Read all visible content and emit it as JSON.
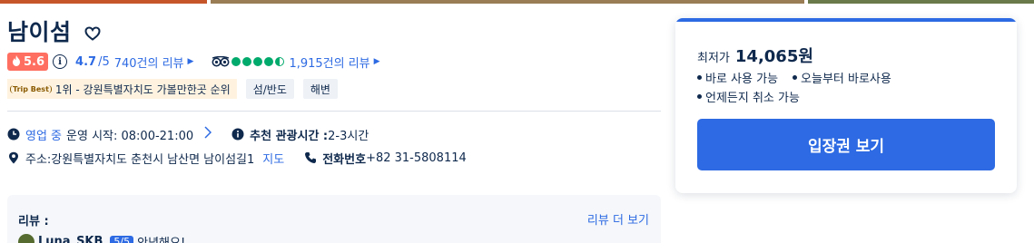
{
  "title": "남이섬",
  "hot_score": "5.6",
  "rating": {
    "score": "4.7",
    "scale": "/5",
    "review_count_text": "740건의 리뷰"
  },
  "tripadvisor": {
    "bubbles_filled": 4.5,
    "review_count_text": "1,915건의 리뷰"
  },
  "tripbest": {
    "label": "Trip Best",
    "text": "1위 - 강원특별자치도 가볼만한곳 순위"
  },
  "tags": [
    "섬/반도",
    "해변"
  ],
  "info": {
    "status": "영업 중",
    "hours": "운영 시작: 08:00-21:00",
    "recommended_label": "추천 관광시간 :",
    "recommended_value": "2-3시간",
    "address": "주소:강원특별자치도 춘천시 남산면 남이섬길1",
    "map_link": "지도",
    "phone_label": "전화번호",
    "phone_value": "+82 31-5808114"
  },
  "review_section": {
    "title": "리뷰 :",
    "more_link": "리뷰 더 보기",
    "first_review": {
      "user": "Luna_SKB",
      "rating": "5/5",
      "snippet": "안녕해요!"
    }
  },
  "booking": {
    "price_label": "최저가",
    "price": "14,065원",
    "features": [
      "바로 사용 가능",
      "오늘부터 바로사용",
      "언제든지 취소 가능"
    ],
    "cta_label": "입장권 보기"
  },
  "colors": {
    "brand_blue": "#2d6ae3",
    "hot_red": "#ff6f61",
    "tripadvisor_green": "#00aa6c",
    "text_dark": "#0f294d"
  }
}
